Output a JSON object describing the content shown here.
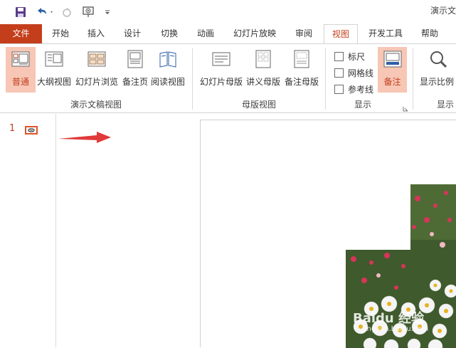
{
  "window": {
    "title": "演示文"
  },
  "quick_access": {
    "save_icon": "save-icon",
    "undo_icon": "undo-icon",
    "redo_icon": "redo-icon",
    "present_icon": "present-from-start-icon",
    "customize_icon": "customize-qat-icon"
  },
  "tabs": [
    {
      "label": "文件"
    },
    {
      "label": "开始"
    },
    {
      "label": "插入"
    },
    {
      "label": "设计"
    },
    {
      "label": "切换"
    },
    {
      "label": "动画"
    },
    {
      "label": "幻灯片放映"
    },
    {
      "label": "审阅"
    },
    {
      "label": "视图"
    },
    {
      "label": "开发工具"
    },
    {
      "label": "帮助"
    }
  ],
  "ribbon": {
    "presentation_views": {
      "label": "演示文稿视图",
      "buttons": [
        {
          "label": "普通"
        },
        {
          "label": "大纲视图"
        },
        {
          "label": "幻灯片浏览"
        },
        {
          "label": "备注页"
        },
        {
          "label": "阅读视图"
        }
      ]
    },
    "master_views": {
      "label": "母版视图",
      "buttons": [
        {
          "label": "幻灯片母版"
        },
        {
          "label": "讲义母版"
        },
        {
          "label": "备注母版"
        }
      ]
    },
    "show": {
      "label": "显示",
      "checkboxes": [
        {
          "label": "标尺"
        },
        {
          "label": "网格线"
        },
        {
          "label": "参考线"
        }
      ],
      "notes_button": "备注"
    },
    "zoom": {
      "label": "显示",
      "button": "显示比例"
    }
  },
  "thumbnails": [
    {
      "number": "1"
    }
  ],
  "watermark": {
    "text": "Baidu 经验",
    "sub": "jingyan.baidu.com"
  },
  "colors": {
    "accent": "#c43e1c",
    "active_fill": "#f7c6b5",
    "arrow": "#e03a3a"
  }
}
